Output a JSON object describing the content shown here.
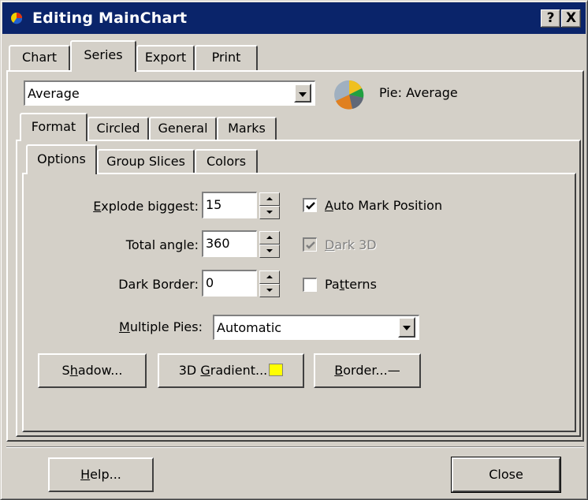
{
  "window": {
    "title": "Editing MainChart",
    "help_button": "?",
    "close_button": "X"
  },
  "top_tabs": [
    "Chart",
    "Series",
    "Export",
    "Print"
  ],
  "active_top_tab": "Series",
  "series_select": {
    "value": "Average",
    "pie_icon": "pie-icon",
    "series_label": "Pie: Average"
  },
  "series_tabs": [
    "Format",
    "Circled",
    "General",
    "Marks"
  ],
  "format_tabs": [
    "Options",
    "Group Slices",
    "Colors"
  ],
  "options": {
    "explode_biggest": {
      "label_pre": "",
      "label_u": "E",
      "label_post": "xplode biggest:",
      "value": "15"
    },
    "total_angle": {
      "label": "Total angle:",
      "value": "360"
    },
    "dark_border": {
      "label": "Dark Border:",
      "value": "0"
    },
    "auto_mark_position": {
      "label_u": "A",
      "label_post": "uto Mark Position",
      "checked": true
    },
    "dark_3d": {
      "label_u": "D",
      "label_post": "ark 3D",
      "checked": true,
      "disabled": true
    },
    "patterns": {
      "label_pre": "Pa",
      "label_u": "t",
      "label_post": "terns",
      "checked": false
    },
    "multiple_pies": {
      "label_u": "M",
      "label_post": "ultiple Pies:",
      "value": "Automatic"
    }
  },
  "buttons": {
    "shadow": {
      "pre": "S",
      "u": "h",
      "post": "adow..."
    },
    "gradient": {
      "pre": "3D ",
      "u": "G",
      "post": "radient...",
      "swatch": "#ffff00"
    },
    "border": {
      "u": "B",
      "post": "order...—"
    },
    "help": {
      "u": "H",
      "post": "elp..."
    },
    "close": "Close"
  }
}
